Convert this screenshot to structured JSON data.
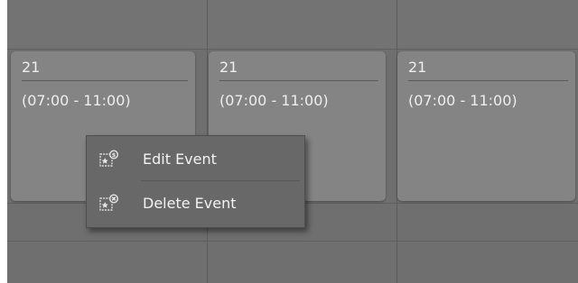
{
  "events": [
    {
      "day": "21",
      "time": "(07:00 - 11:00)"
    },
    {
      "day": "21",
      "time": "(07:00 - 11:00)"
    },
    {
      "day": "21",
      "time": "(07:00 - 11:00)"
    }
  ],
  "context_menu": {
    "items": [
      {
        "label": "Edit Event",
        "icon": "edit-event-icon"
      },
      {
        "label": "Delete Event",
        "icon": "delete-event-icon"
      }
    ]
  },
  "colors": {
    "grid_background": "#6f6f6f",
    "card_background": "#848484",
    "menu_background": "#686868",
    "text": "#eeeeee"
  }
}
